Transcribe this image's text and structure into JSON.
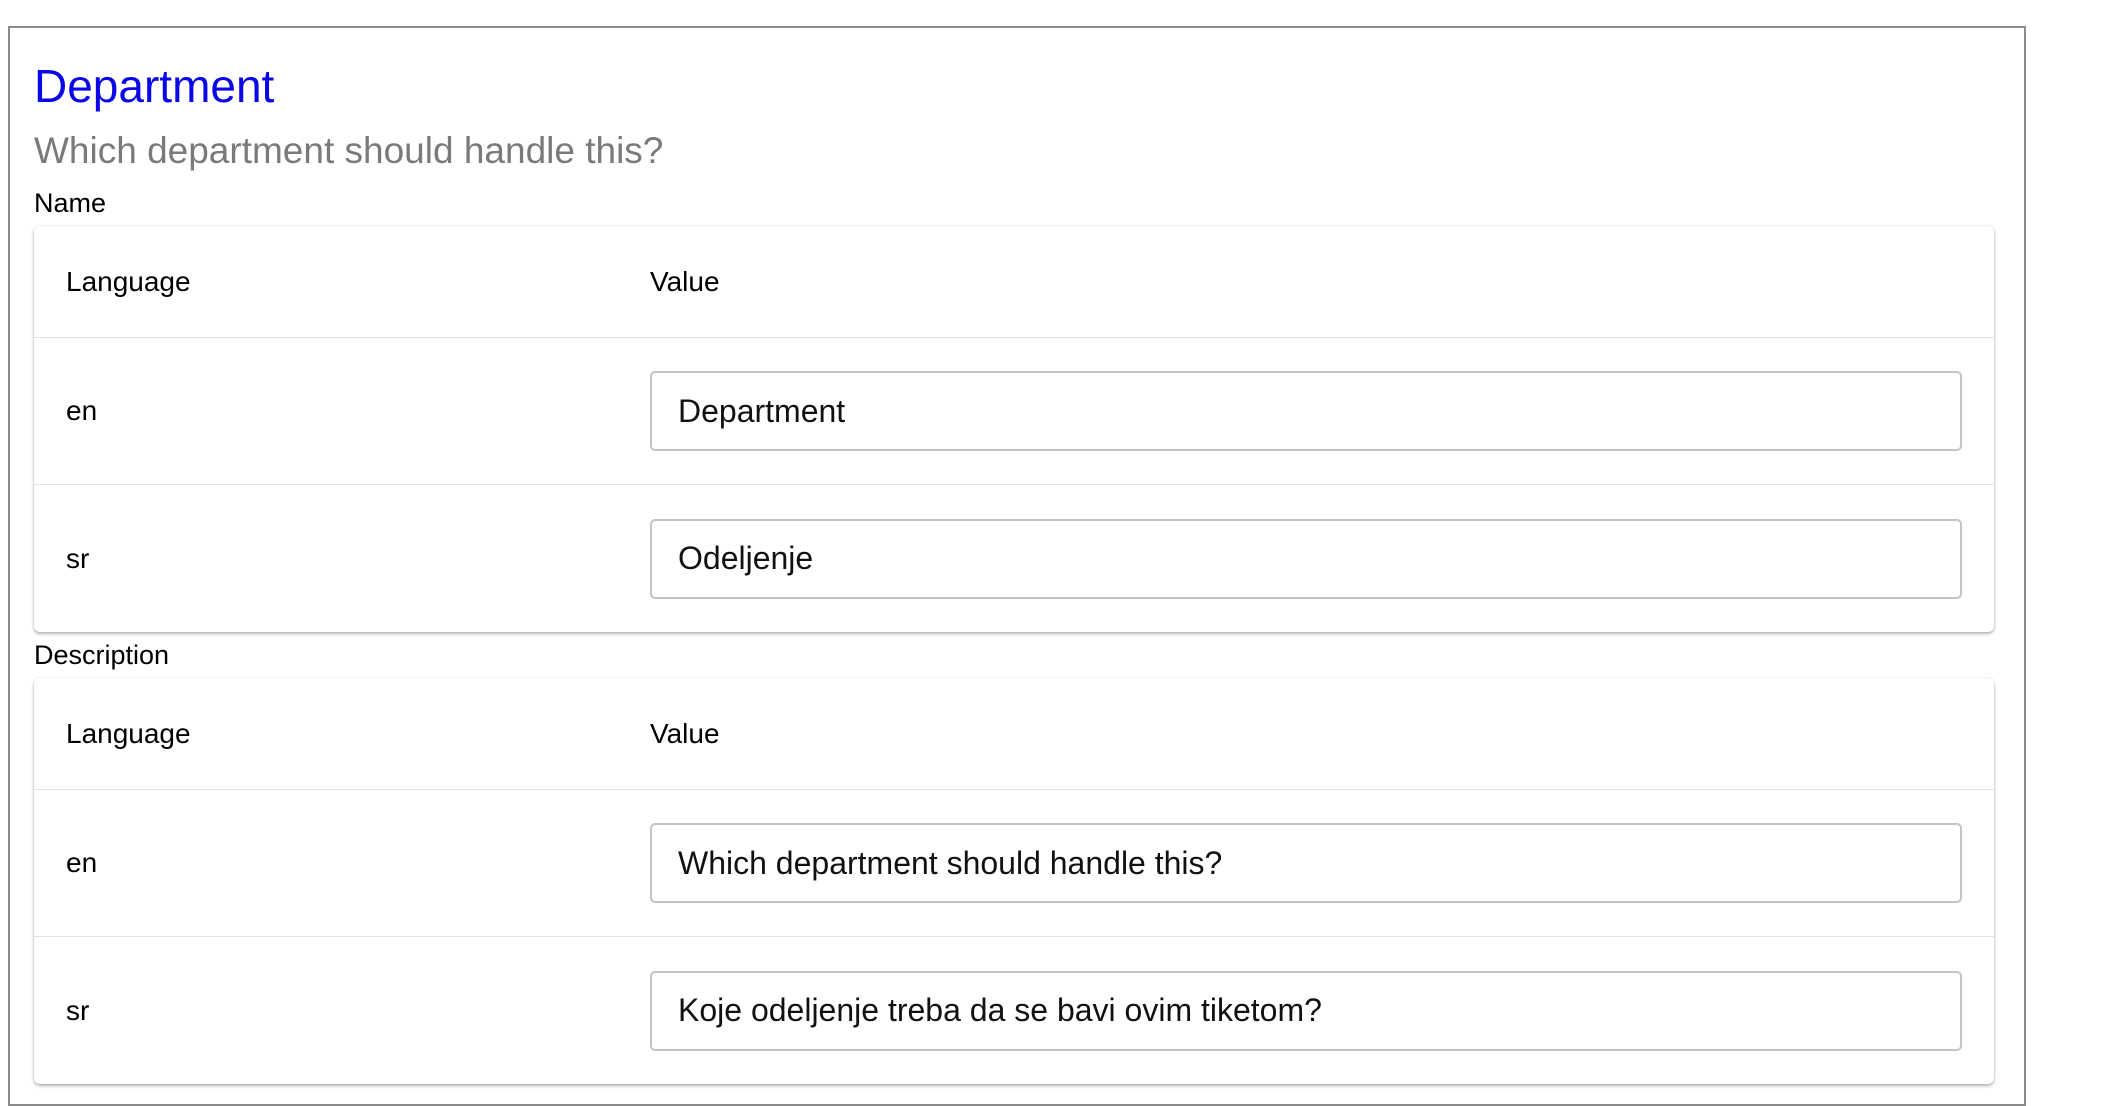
{
  "field": {
    "title": "Department",
    "subtitle": "Which department should handle this?"
  },
  "name_section": {
    "label": "Name",
    "header": {
      "language": "Language",
      "value": "Value"
    },
    "rows": [
      {
        "language": "en",
        "value": "Department"
      },
      {
        "language": "sr",
        "value": "Odeljenje"
      }
    ]
  },
  "description_section": {
    "label": "Description",
    "header": {
      "language": "Language",
      "value": "Value"
    },
    "rows": [
      {
        "language": "en",
        "value": "Which department should handle this?"
      },
      {
        "language": "sr",
        "value": "Koje odeljenje treba da se bavi ovim tiketom?"
      }
    ]
  },
  "colors": {
    "title": "#0a07e6",
    "subtitle": "#7a7a7a",
    "frame_border": "#8a8a8a"
  }
}
